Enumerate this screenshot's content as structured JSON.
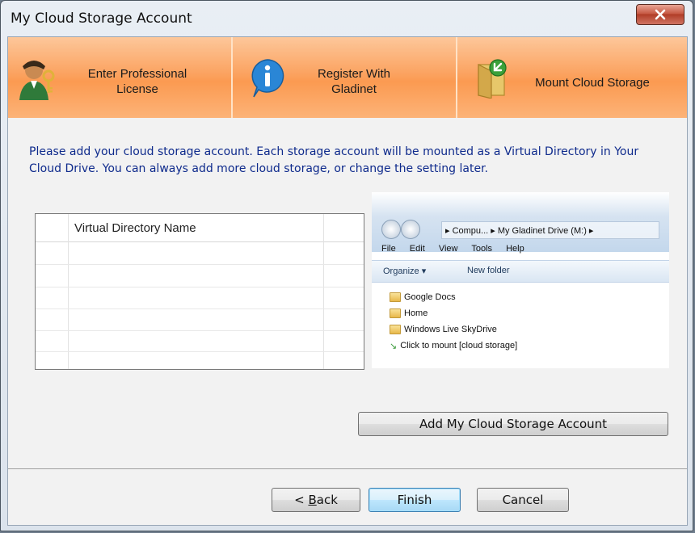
{
  "window": {
    "title": "My Cloud Storage Account"
  },
  "steps": [
    {
      "label": "Enter Professional\nLicense",
      "line1": "Enter Professional",
      "line2": "License",
      "icon": "user-key-icon"
    },
    {
      "label": "Register With Gladinet",
      "line1": "Register With",
      "line2": "Gladinet",
      "icon": "info-icon"
    },
    {
      "label": "Mount Cloud Storage",
      "line1": "Mount Cloud Storage",
      "icon": "mount-folder-icon"
    }
  ],
  "description": "Please add your cloud storage account. Each storage account will be mounted as a Virtual Directory in Your Cloud Drive. You can always add more cloud storage, or change the setting later.",
  "grid": {
    "column_header": "Virtual Directory Name",
    "rows": []
  },
  "preview": {
    "address": "▸ Compu... ▸ My Gladinet Drive (M:) ▸",
    "menu": [
      "File",
      "Edit",
      "View",
      "Tools",
      "Help"
    ],
    "toolbar": {
      "organize": "Organize ▾",
      "new_folder": "New folder"
    },
    "items": [
      "Google Docs",
      "Home",
      "Windows Live SkyDrive",
      "Click to mount [cloud storage]"
    ]
  },
  "buttons": {
    "add_account": "Add My Cloud Storage Account",
    "back_prefix": "< ",
    "back_accel": "B",
    "back_rest": "ack",
    "finish": "Finish",
    "cancel": "Cancel"
  }
}
